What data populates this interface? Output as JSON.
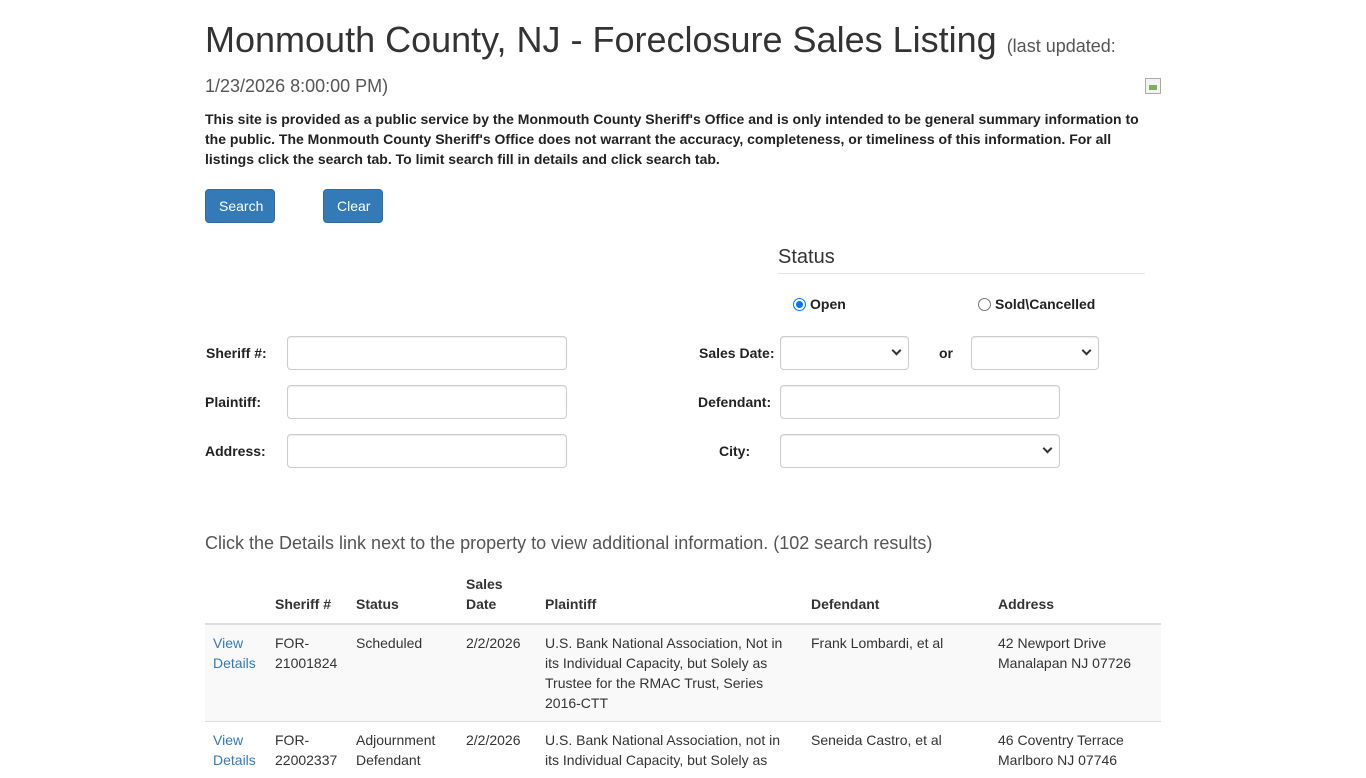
{
  "page": {
    "title": "Monmouth County, NJ - Foreclosure Sales Listing",
    "updated_prefix": "(last updated:",
    "updated_value": "1/23/2026 8:00:00 PM)",
    "notice": "This site is provided as a public service by the Monmouth County Sheriff's Office and is only intended to be general summary information to the public. The Monmouth County Sheriff's Office does not warrant the accuracy, completeness, or timeliness of this information. For all listings click the search tab. To limit search fill in details and click search tab."
  },
  "buttons": {
    "search": "Search",
    "clear": "Clear"
  },
  "status": {
    "heading": "Status",
    "options": [
      "Open",
      "Sold\\Cancelled"
    ],
    "selected": "Open"
  },
  "form": {
    "sheriff_label": "Sheriff #:",
    "plaintiff_label": "Plaintiff:",
    "address_label": "Address:",
    "sales_date_label": "Sales Date:",
    "or_label": "or",
    "defendant_label": "Defendant:",
    "city_label": "City:",
    "sheriff_value": "",
    "plaintiff_value": "",
    "address_value": "",
    "defendant_value": ""
  },
  "results": {
    "info": "Click the Details link next to the property to view additional information. (102 search results)",
    "headers": [
      "",
      "Sheriff #",
      "Status",
      "Sales Date",
      "Plaintiff",
      "Defendant",
      "Address"
    ],
    "rows": [
      {
        "link": "View Details",
        "sheriff": "FOR-21001824",
        "status": "Scheduled",
        "date": "2/2/2026",
        "plaintiff": "U.S. Bank National Association, Not in its Individual Capacity, but Solely as Trustee for the RMAC Trust, Series 2016-CTT",
        "defendant": "Frank Lombardi, et al",
        "address_line1": "42 Newport Drive",
        "address_line2": "Manalapan NJ 07726"
      },
      {
        "link": "View Details",
        "sheriff": "FOR-22002337",
        "status": "Adjournment Defendant",
        "date": "2/2/2026",
        "plaintiff": "U.S. Bank National Association, not in its Individual Capacity, but Solely as",
        "defendant": "Seneida Castro, et al",
        "address_line1": "46 Coventry Terrace",
        "address_line2": "Marlboro NJ 07746"
      }
    ]
  }
}
